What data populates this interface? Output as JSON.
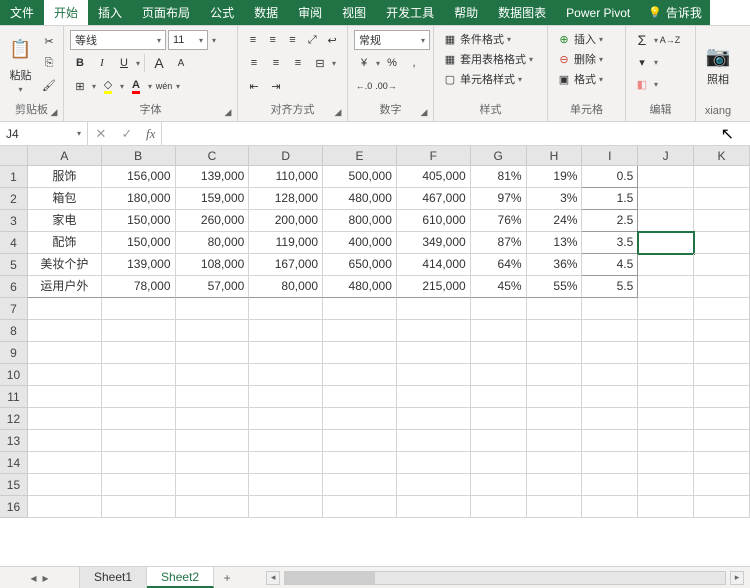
{
  "menubar": {
    "tabs": [
      "文件",
      "开始",
      "插入",
      "页面布局",
      "公式",
      "数据",
      "审阅",
      "视图",
      "开发工具",
      "帮助",
      "数据图表",
      "Power Pivot"
    ],
    "active_index": 1,
    "tellme_icon": "lightbulb-icon",
    "tellme_label": "告诉我"
  },
  "ribbon": {
    "clipboard": {
      "paste_label": "粘贴",
      "group_label": "剪贴板"
    },
    "font": {
      "font_name": "等线",
      "font_size": "11",
      "bold": "B",
      "italic": "I",
      "underline": "U",
      "grow": "A",
      "shrink": "A",
      "phonetic": "wén",
      "group_label": "字体"
    },
    "alignment": {
      "group_label": "对齐方式"
    },
    "number": {
      "format": "常规",
      "percent": "%",
      "comma": ",",
      "inc_dec": "00",
      "dec_dec": "00",
      "group_label": "数字"
    },
    "styles": {
      "cond_format": "条件格式",
      "table_format": "套用表格格式",
      "cell_styles": "单元格样式",
      "group_label": "样式"
    },
    "cells": {
      "insert": "插入",
      "delete": "删除",
      "format": "格式",
      "group_label": "单元格"
    },
    "editing": {
      "autosum": "Σ",
      "sort": "A→Z",
      "group_label": "编辑"
    },
    "camera": {
      "label": "照相"
    },
    "xiang": "xiang"
  },
  "namebox": {
    "ref": "J4",
    "fx": "fx"
  },
  "grid": {
    "columns": [
      "A",
      "B",
      "C",
      "D",
      "E",
      "F",
      "G",
      "H",
      "I",
      "J",
      "K"
    ],
    "row_count": 16,
    "selected": {
      "row": 4,
      "col": "J"
    },
    "data": [
      {
        "A": "服饰",
        "B": "156,000",
        "C": "139,000",
        "D": "110,000",
        "E": "500,000",
        "F": "405,000",
        "G": "81%",
        "H": "19%",
        "I": "0.5"
      },
      {
        "A": "箱包",
        "B": "180,000",
        "C": "159,000",
        "D": "128,000",
        "E": "480,000",
        "F": "467,000",
        "G": "97%",
        "H": "3%",
        "I": "1.5"
      },
      {
        "A": "家电",
        "B": "150,000",
        "C": "260,000",
        "D": "200,000",
        "E": "800,000",
        "F": "610,000",
        "G": "76%",
        "H": "24%",
        "I": "2.5"
      },
      {
        "A": "配饰",
        "B": "150,000",
        "C": "80,000",
        "D": "119,000",
        "E": "400,000",
        "F": "349,000",
        "G": "87%",
        "H": "13%",
        "I": "3.5"
      },
      {
        "A": "美妆个护",
        "B": "139,000",
        "C": "108,000",
        "D": "167,000",
        "E": "650,000",
        "F": "414,000",
        "G": "64%",
        "H": "36%",
        "I": "4.5"
      },
      {
        "A": "运用户外",
        "B": "78,000",
        "C": "57,000",
        "D": "80,000",
        "E": "480,000",
        "F": "215,000",
        "G": "45%",
        "H": "55%",
        "I": "5.5"
      }
    ]
  },
  "sheetbar": {
    "sheets": [
      "Sheet1",
      "Sheet2"
    ],
    "active_index": 1,
    "add": "+"
  }
}
